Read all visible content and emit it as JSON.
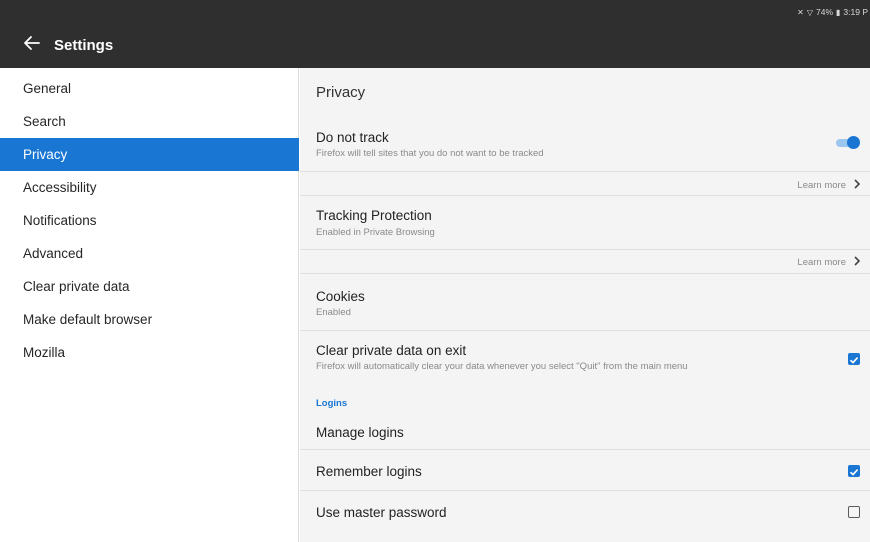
{
  "status_bar": {
    "mute_icon": "mute-icon",
    "wifi_icon": "wifi-icon",
    "battery": "74%",
    "time": "3:19 P"
  },
  "appbar": {
    "back_icon": "back-arrow-icon",
    "title": "Settings"
  },
  "nav": {
    "items": [
      {
        "label": "General",
        "selected": false
      },
      {
        "label": "Search",
        "selected": false
      },
      {
        "label": "Privacy",
        "selected": true
      },
      {
        "label": "Accessibility",
        "selected": false
      },
      {
        "label": "Notifications",
        "selected": false
      },
      {
        "label": "Advanced",
        "selected": false
      },
      {
        "label": "Clear private data",
        "selected": false
      },
      {
        "label": "Make default browser",
        "selected": false
      },
      {
        "label": "Mozilla",
        "selected": false
      }
    ]
  },
  "privacy": {
    "title": "Privacy",
    "do_not_track": {
      "title": "Do not track",
      "subtitle": "Firefox will tell sites that you do not want to be tracked",
      "enabled": true
    },
    "learn_more_1": "Learn more",
    "tracking_protection": {
      "title": "Tracking Protection",
      "subtitle": "Enabled in Private Browsing"
    },
    "learn_more_2": "Learn more",
    "cookies": {
      "title": "Cookies",
      "subtitle": "Enabled"
    },
    "clear_on_exit": {
      "title": "Clear private data on exit",
      "subtitle": "Firefox will automatically clear your data whenever you select \"Quit\" from the main menu",
      "checked": true
    },
    "logins_label": "Logins",
    "manage_logins": "Manage logins",
    "remember_logins": {
      "title": "Remember logins",
      "checked": true
    },
    "master_password": {
      "title": "Use master password",
      "checked": false
    }
  },
  "colors": {
    "accent": "#1976d2",
    "appbar": "#2f2f2f",
    "pane_bg": "#f4f4f4"
  }
}
